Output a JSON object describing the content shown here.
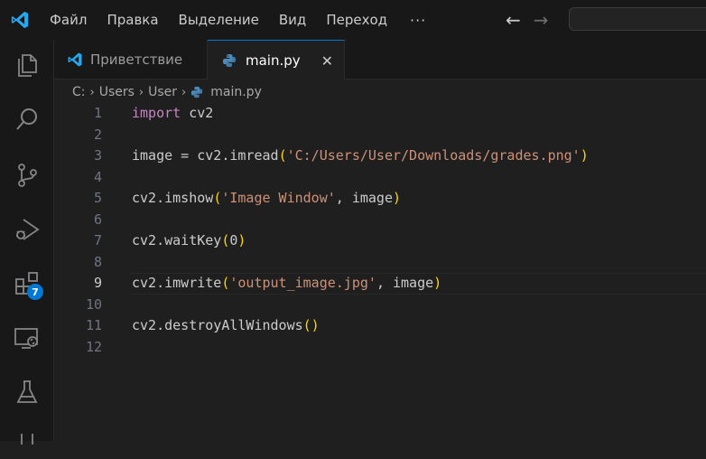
{
  "menu": {
    "items": [
      "Файл",
      "Правка",
      "Выделение",
      "Вид",
      "Переход"
    ],
    "more": "···"
  },
  "nav": {
    "back": "←",
    "forward": "→"
  },
  "tabs": [
    {
      "label": "Приветствие",
      "active": false
    },
    {
      "label": "main.py",
      "active": true,
      "close": "✕"
    }
  ],
  "breadcrumb": {
    "parts": [
      "C:",
      "Users",
      "User",
      "main.py"
    ],
    "separator": "›"
  },
  "activity": {
    "extensions_badge": "7"
  },
  "editor": {
    "active_line": 9,
    "line_numbers": [
      "1",
      "2",
      "3",
      "4",
      "5",
      "6",
      "7",
      "8",
      "9",
      "10",
      "11",
      "12"
    ],
    "lines": [
      [
        {
          "t": "import",
          "c": "kw"
        },
        {
          "t": " cv2",
          "c": "fn"
        }
      ],
      [],
      [
        {
          "t": "image = cv2.imread",
          "c": "fn"
        },
        {
          "t": "(",
          "c": "paren"
        },
        {
          "t": "'C:/Users/User/Downloads/grades.png'",
          "c": "str"
        },
        {
          "t": ")",
          "c": "paren"
        }
      ],
      [],
      [
        {
          "t": "cv2.imshow",
          "c": "fn"
        },
        {
          "t": "(",
          "c": "paren"
        },
        {
          "t": "'Image Window'",
          "c": "str"
        },
        {
          "t": ", image",
          "c": "fn"
        },
        {
          "t": ")",
          "c": "paren"
        }
      ],
      [],
      [
        {
          "t": "cv2.waitKey",
          "c": "fn"
        },
        {
          "t": "(",
          "c": "paren"
        },
        {
          "t": "0",
          "c": "fn"
        },
        {
          "t": ")",
          "c": "paren"
        }
      ],
      [],
      [
        {
          "t": "cv2.imwrite",
          "c": "fn"
        },
        {
          "t": "(",
          "c": "paren"
        },
        {
          "t": "'output_image.jpg'",
          "c": "str"
        },
        {
          "t": ", image",
          "c": "fn"
        },
        {
          "t": ")",
          "c": "paren"
        }
      ],
      [],
      [
        {
          "t": "cv2.destroyAllWindows",
          "c": "fn"
        },
        {
          "t": "()",
          "c": "paren"
        }
      ],
      []
    ]
  },
  "colors": {
    "accent": "#0078d4",
    "keyword": "#c586c0",
    "string": "#ce9178",
    "bracket": "#ffd700",
    "python_icon": "#4b8bbe"
  }
}
